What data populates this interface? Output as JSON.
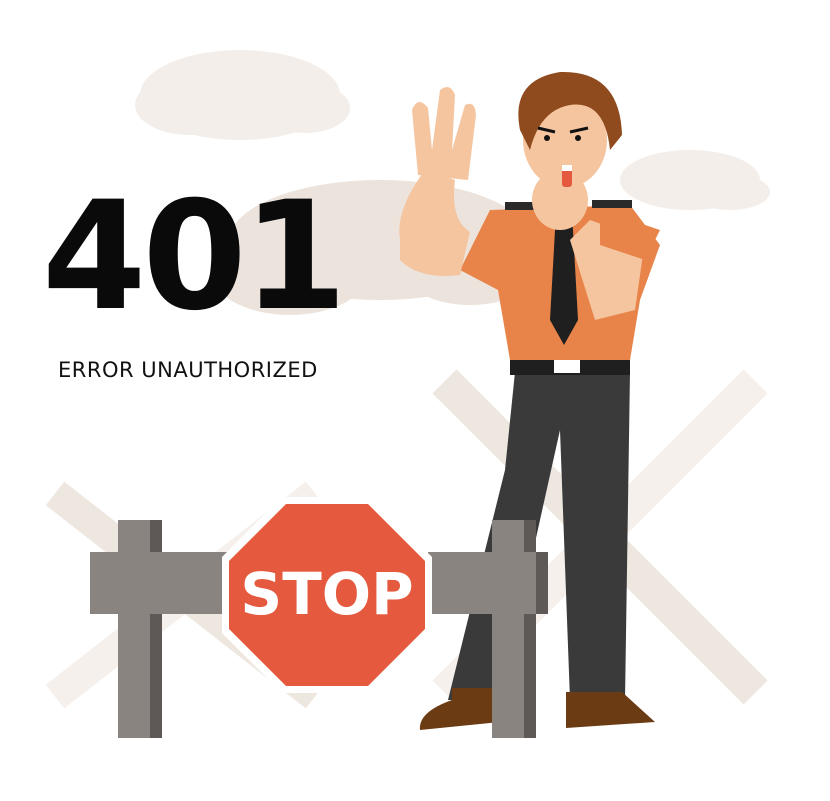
{
  "error": {
    "code": "401",
    "message": "ERROR UNAUTHORIZED"
  },
  "sign": {
    "text": "STOP"
  },
  "colors": {
    "stop_red": "#e55a3e",
    "shirt_orange": "#e8844a",
    "barrier_gray": "#8a8481",
    "cloud_beige": "#ece4dc"
  }
}
